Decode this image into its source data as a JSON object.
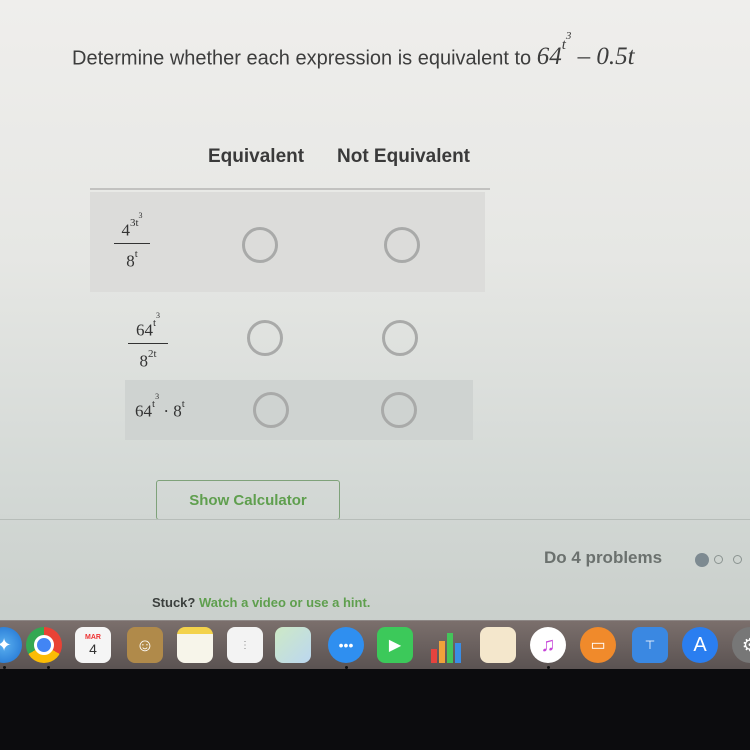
{
  "question": {
    "prompt": "Determine whether each expression is equivalent to",
    "target_base": "64",
    "target_exponent_base": "t",
    "target_exponent_power": "3",
    "target_suffix": "– 0.5t"
  },
  "columns": {
    "equivalent": "Equivalent",
    "not_equivalent": "Not Equivalent"
  },
  "rows": [
    {
      "type": "fraction",
      "numerator": {
        "base": "4",
        "exp": "3t",
        "exp_power": "3"
      },
      "denominator": {
        "base": "8",
        "exp": "t"
      },
      "equivalent_selected": false,
      "not_equivalent_selected": false
    },
    {
      "type": "fraction",
      "numerator": {
        "base": "64",
        "exp": "t",
        "exp_power": "3"
      },
      "denominator": {
        "base": "8",
        "exp": "2t"
      },
      "equivalent_selected": false,
      "not_equivalent_selected": false
    },
    {
      "type": "product",
      "left": {
        "base": "64",
        "exp": "t",
        "exp_power": "3"
      },
      "operator": "·",
      "right": {
        "base": "8",
        "exp": "t"
      },
      "equivalent_selected": false,
      "not_equivalent_selected": false
    }
  ],
  "buttons": {
    "show_calculator": "Show Calculator"
  },
  "progress": {
    "label": "Do 4 problems",
    "completed": 1,
    "visible_dots": 3
  },
  "help": {
    "stuck": "Stuck?",
    "link": "Watch a video or use a hint."
  },
  "colors": {
    "accent_green": "#5f9f4e",
    "radio_border": "#a9aaa9"
  },
  "dock": {
    "calendar_month": "MAR",
    "calendar_day": "4",
    "apps": [
      "safari",
      "chrome",
      "calendar",
      "contacts",
      "notes",
      "reminders",
      "maps",
      "messages",
      "facetime",
      "numbers",
      "pages",
      "itunes",
      "ibooks",
      "keynote",
      "app-store",
      "system-preferences"
    ]
  }
}
